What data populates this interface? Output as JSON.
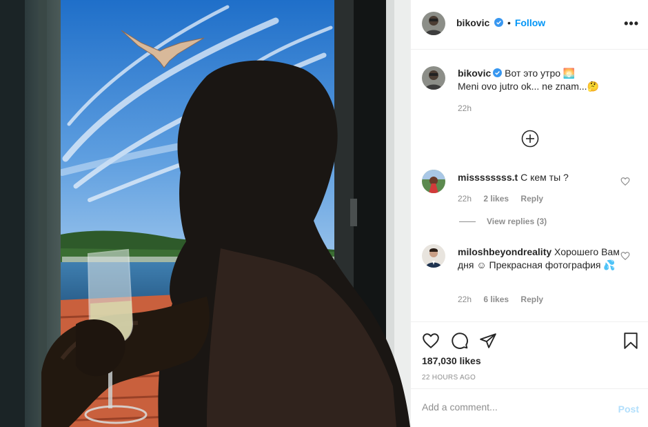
{
  "author": {
    "username": "bikovic",
    "follow_label": "Follow",
    "follow_dot": "•",
    "more_label": "•••"
  },
  "caption": {
    "username": "bikovic",
    "line1": "Вот это утро 🌅",
    "line2": "Meni ovo jutro ok... ne znam...🤔",
    "time": "22h"
  },
  "comments": [
    {
      "username": "missssssss.t",
      "text": "С кем ты ?",
      "time": "22h",
      "likes": "2 likes",
      "reply": "Reply"
    },
    {
      "username": "miloshbeyondreality",
      "text": "Хорошего Вам дня ☺ Прекрасная фотография 💦",
      "time": "22h",
      "likes": "6 likes",
      "reply": "Reply"
    }
  ],
  "view_replies": "View replies (3)",
  "likes_count": "187,030 likes",
  "posted_ago": "22 HOURS AGO",
  "add_comment": {
    "placeholder": "Add a comment...",
    "post_label": "Post"
  },
  "colors": {
    "link_blue": "#0095f6",
    "muted": "#8e8e8e",
    "post_disabled": "#b2dffc"
  }
}
